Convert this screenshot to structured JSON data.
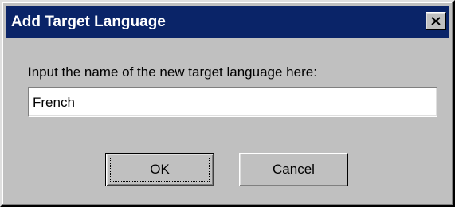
{
  "window": {
    "title": "Add Target Language",
    "close_icon": "close-x-icon"
  },
  "colors": {
    "titlebar": "#0a2468",
    "face": "#c0c0c0"
  },
  "form": {
    "prompt": "Input the name of the new target language here:",
    "value": "French"
  },
  "buttons": {
    "ok_label": "OK",
    "cancel_label": "Cancel"
  }
}
